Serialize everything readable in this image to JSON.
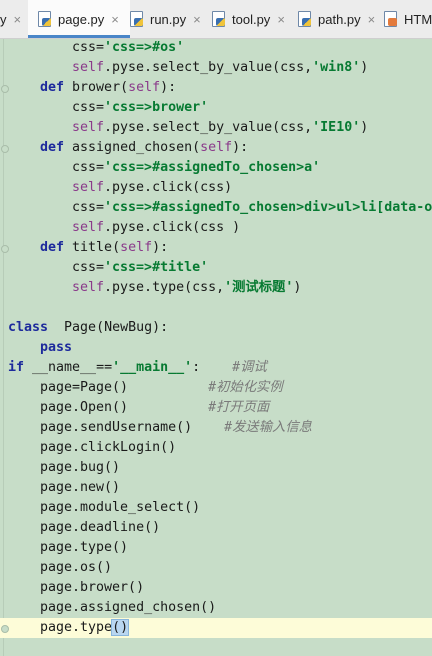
{
  "tabs": [
    {
      "label": "y",
      "close": "×"
    },
    {
      "label": "page.py",
      "close": "×"
    },
    {
      "label": "run.py",
      "close": "×"
    },
    {
      "label": "tool.py",
      "close": "×"
    },
    {
      "label": "path.py",
      "close": "×"
    },
    {
      "label": "HTML",
      "close": ""
    }
  ],
  "code": {
    "l1": {
      "a": "css=",
      "s": "'css=>#os'"
    },
    "l2": {
      "self": "self",
      "a": ".pyse.select_by_value(css,",
      "s": "'win8'",
      "b": ")"
    },
    "l3": {
      "kw": "def",
      "a": " brower(",
      "self": "self",
      "b": "):"
    },
    "l4": {
      "a": "css=",
      "s": "'css=>brower'"
    },
    "l5": {
      "self": "self",
      "a": ".pyse.select_by_value(css,",
      "s": "'IE10'",
      "b": ")"
    },
    "l6": {
      "kw": "def",
      "a": " assigned_chosen(",
      "self": "self",
      "b": "):"
    },
    "l7": {
      "a": "css=",
      "s": "'css=>#assignedTo_chosen>a'"
    },
    "l8": {
      "self": "self",
      "a": ".pyse.click(css)"
    },
    "l9": {
      "a": "css=",
      "s": "'css=>#assignedTo_chosen>div>ul>li[data-o"
    },
    "l10": {
      "self": "self",
      "a": ".pyse.click(css )"
    },
    "l11": {
      "kw": "def",
      "a": " title(",
      "self": "self",
      "b": "):"
    },
    "l12": {
      "a": "css=",
      "s": "'css=>#title'"
    },
    "l13": {
      "self": "self",
      "a": ".pyse.type(css,",
      "s": "'测试标题'",
      "b": ")"
    },
    "l14": {
      "kw": "class",
      "a": "  Page(NewBug):"
    },
    "l15": {
      "kw": "pass"
    },
    "l16": {
      "kw": "if",
      "a": " __name__==",
      "s": "'__main__'",
      "b": ":    ",
      "cm": "#调试"
    },
    "l17": {
      "a": "page=Page()          ",
      "cm": "#初始化实例"
    },
    "l18": {
      "a": "page.Open()          ",
      "cm": "#打开页面"
    },
    "l19": {
      "a": "page.sendUsername()    ",
      "cm": "#发送输入信息"
    },
    "l20": {
      "a": "page.clickLogin()"
    },
    "l21": {
      "a": "page.bug()"
    },
    "l22": {
      "a": "page.new()"
    },
    "l23": {
      "a": "page.module_select()"
    },
    "l24": {
      "a": "page.deadline()"
    },
    "l25": {
      "a": "page.type()"
    },
    "l26": {
      "a": "page.os()"
    },
    "l27": {
      "a": "page.brower()"
    },
    "l28": {
      "a": "page.assigned_chosen()"
    },
    "l29": {
      "a": "page.type",
      "p": "()"
    }
  }
}
